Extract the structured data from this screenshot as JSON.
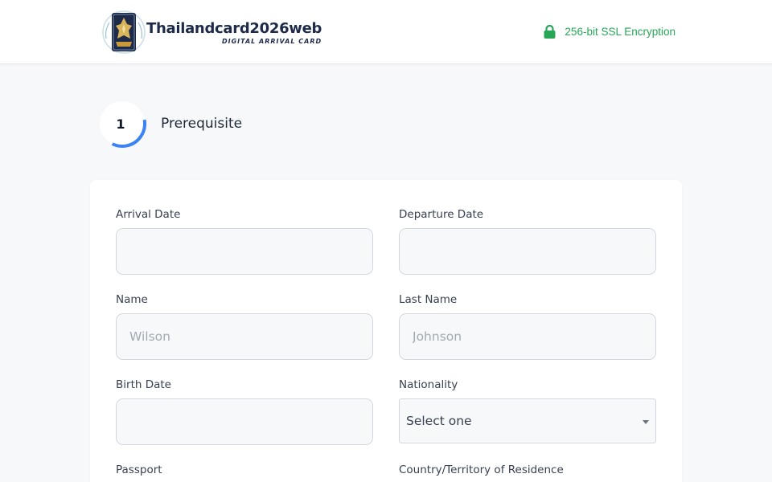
{
  "header": {
    "brand_title": "Thailandcard2026web",
    "brand_subtitle": "DIGITAL ARRIVAL CARD",
    "ssl_text": "256-bit SSL Encryption"
  },
  "step": {
    "number": "1",
    "label": "Prerequisite",
    "progress": 0.35
  },
  "form": {
    "arrival_date": {
      "label": "Arrival Date",
      "value": "",
      "placeholder": ""
    },
    "departure_date": {
      "label": "Departure Date",
      "value": "",
      "placeholder": ""
    },
    "name": {
      "label": "Name",
      "value": "",
      "placeholder": "Wilson"
    },
    "last_name": {
      "label": "Last Name",
      "value": "",
      "placeholder": "Johnson"
    },
    "birth_date": {
      "label": "Birth Date",
      "value": "",
      "placeholder": ""
    },
    "nationality": {
      "label": "Nationality",
      "selected": "Select one"
    },
    "passport": {
      "label": "Passport"
    },
    "residence": {
      "label": "Country/Territory of Residence"
    }
  },
  "colors": {
    "accent": "#3b82f6",
    "ssl_green": "#27a658",
    "brand_navy": "#1e2a4a"
  }
}
